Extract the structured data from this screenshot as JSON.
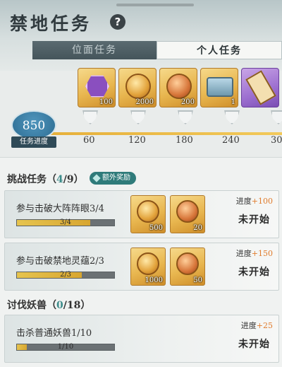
{
  "header": {
    "title": "禁地任务",
    "help_icon": "question-icon",
    "help_label": "?"
  },
  "tabs": [
    {
      "label": "位面任务",
      "active": false
    },
    {
      "label": "个人任务",
      "active": true
    }
  ],
  "rewards": [
    {
      "icon": "purple-crest-icon",
      "qty": "100"
    },
    {
      "icon": "gold-coin-icon",
      "qty": "2000"
    },
    {
      "icon": "red-coin-icon",
      "qty": "200"
    },
    {
      "icon": "treasure-chest-icon",
      "qty": "1"
    },
    {
      "icon": "scroll-icon",
      "qty": ""
    }
  ],
  "task_progress": {
    "value": "850",
    "label": "任务进度",
    "milestones": [
      "60",
      "120",
      "180",
      "240",
      "30"
    ]
  },
  "challenge_section": {
    "title": "挑战任务",
    "open": "（",
    "current": "4",
    "total": "/9）",
    "bonus": "额外奖励"
  },
  "challenge_tasks": [
    {
      "name": "参与击破大阵阵眼3/4",
      "bar_text": "3/4",
      "bar_fraction": 0.75,
      "rewards": [
        {
          "icon": "gold-coin-icon",
          "qty": "500"
        },
        {
          "icon": "red-coin-icon",
          "qty": "20"
        }
      ],
      "progress_label": "进度",
      "progress_plus": "+100",
      "status": "未开始"
    },
    {
      "name": "参与击破禁地灵蕴2/3",
      "bar_text": "2/3",
      "bar_fraction": 0.6667,
      "rewards": [
        {
          "icon": "gold-coin-icon",
          "qty": "1000"
        },
        {
          "icon": "red-coin-icon",
          "qty": "50"
        }
      ],
      "progress_label": "进度",
      "progress_plus": "+150",
      "status": "未开始"
    }
  ],
  "beast_section": {
    "title": "讨伐妖兽",
    "open": "（",
    "current": "0",
    "total": "/18）"
  },
  "beast_tasks": [
    {
      "name": "击杀普通妖兽1/10",
      "bar_text": "1/10",
      "bar_fraction": 0.1,
      "progress_label": "进度",
      "progress_plus": "+25",
      "status": "未开始"
    }
  ]
}
